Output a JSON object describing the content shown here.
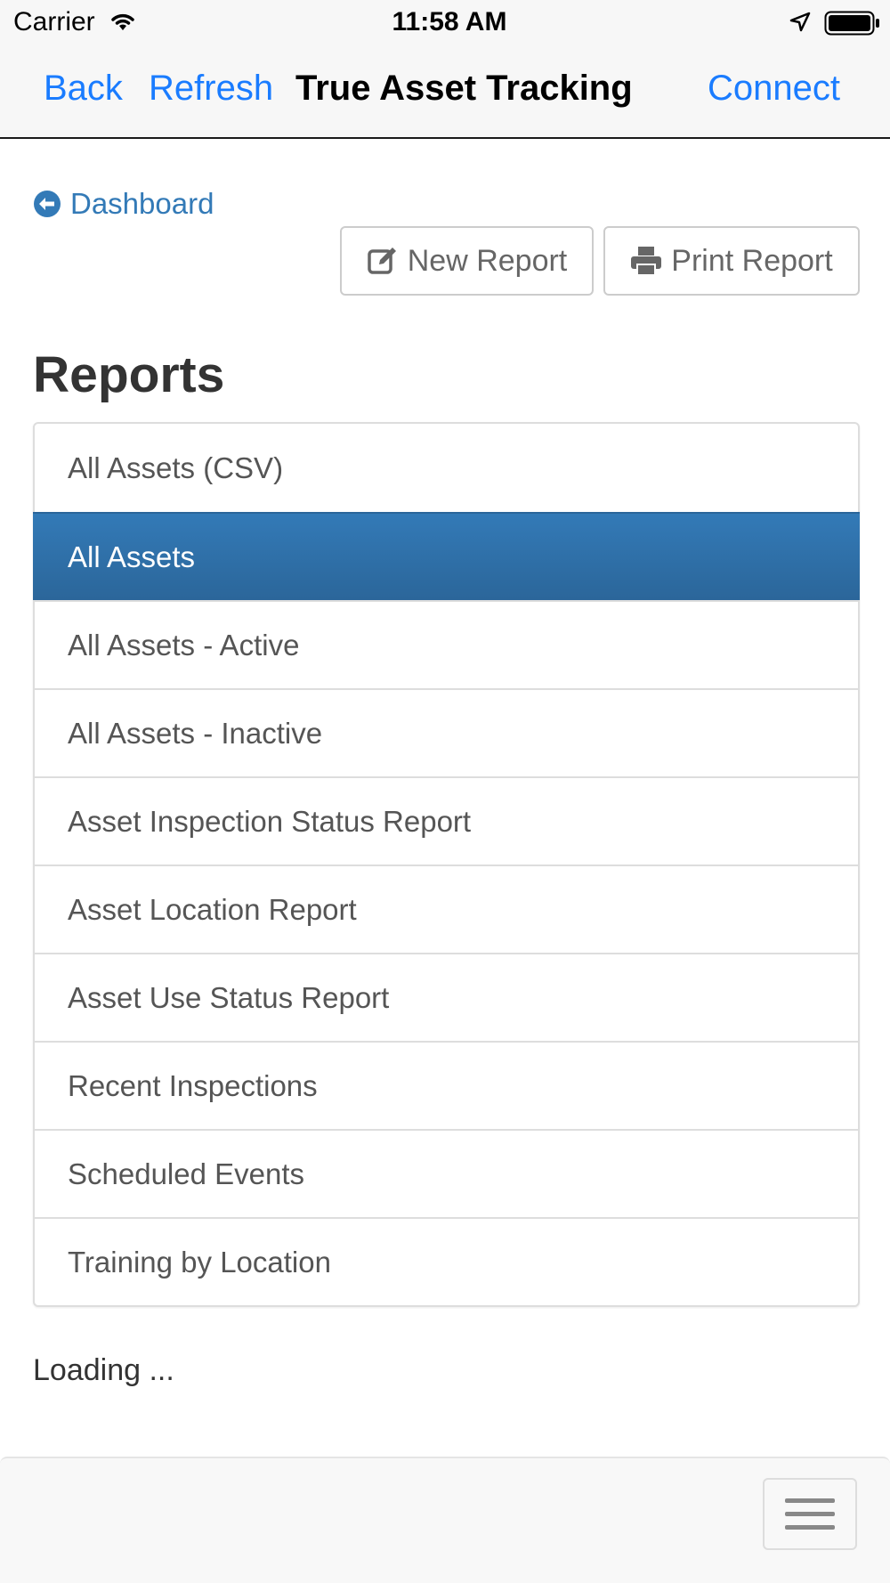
{
  "status_bar": {
    "carrier": "Carrier",
    "time": "11:58 AM"
  },
  "nav": {
    "back": "Back",
    "refresh": "Refresh",
    "title": "True Asset Tracking",
    "connect": "Connect"
  },
  "dashboard_link": "Dashboard",
  "buttons": {
    "new_report": "New Report",
    "print_report": "Print Report"
  },
  "heading": "Reports",
  "reports": [
    "All Assets (CSV)",
    "All Assets",
    "All Assets - Active",
    "All Assets - Inactive",
    "Asset Inspection Status Report",
    "Asset Location Report",
    "Asset Use Status Report",
    "Recent Inspections",
    "Scheduled Events",
    "Training by Location"
  ],
  "selected_report": "All Assets",
  "loading_text": "Loading ...",
  "colors": {
    "nav_link": "#1a7cff",
    "link": "#337ab7",
    "active_bg": "#337ab7"
  }
}
